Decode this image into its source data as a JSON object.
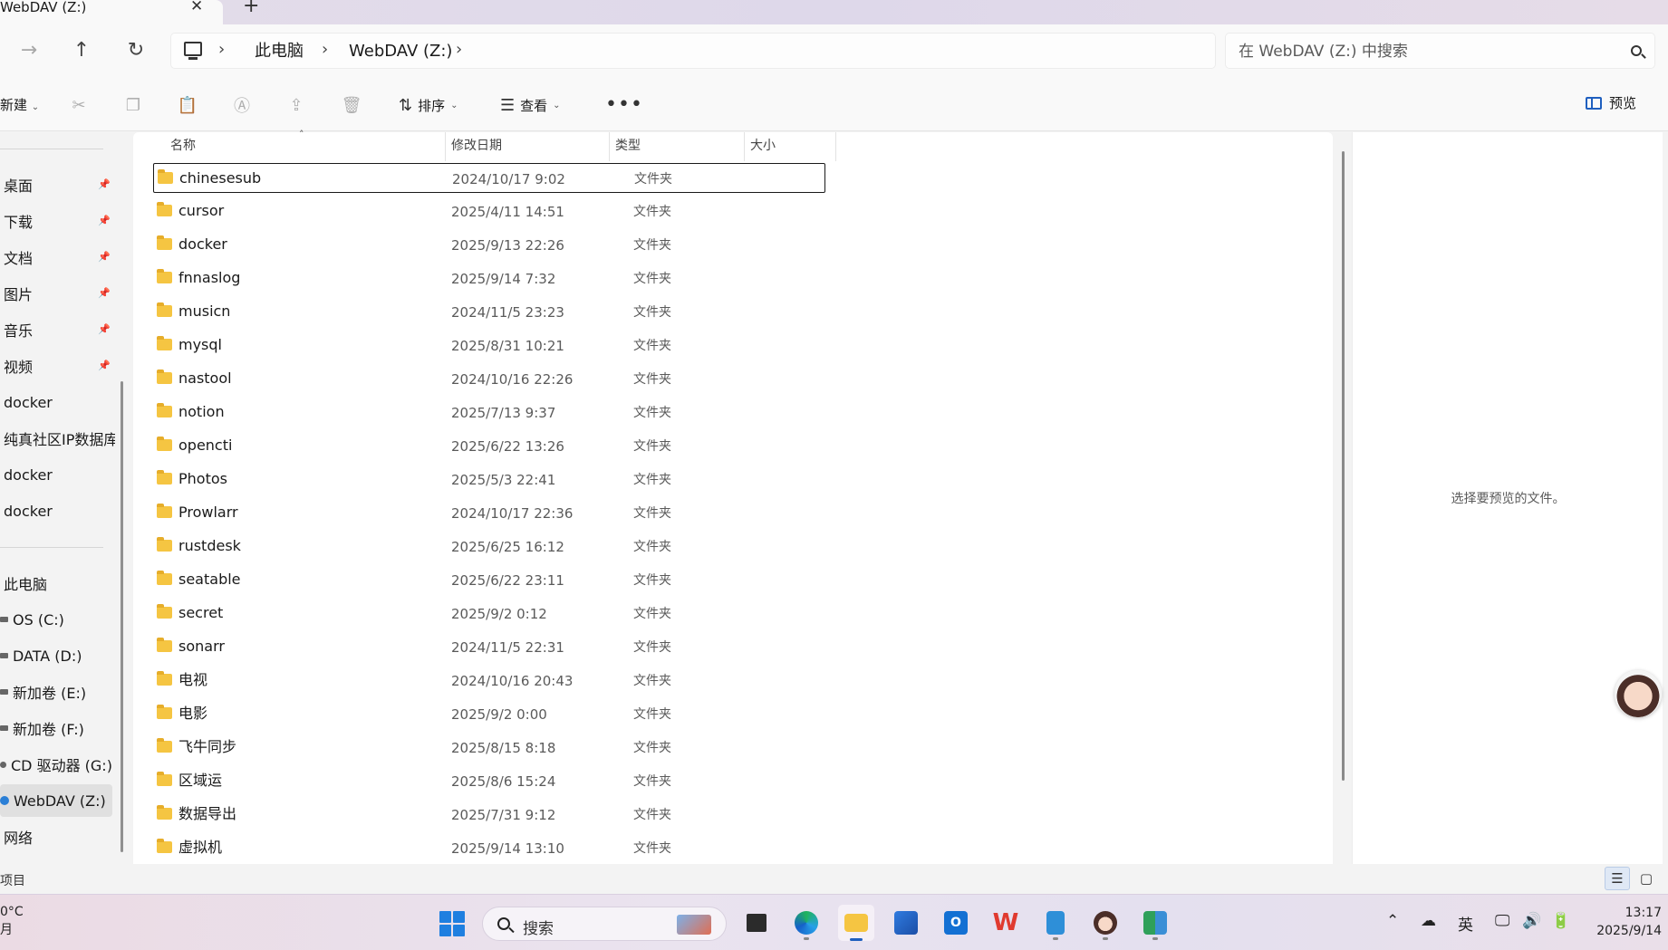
{
  "window": {
    "tab_title": "WebDAV (Z:)",
    "tab_close": "✕",
    "tab_new": "+"
  },
  "address": {
    "breadcrumbs": [
      "此电脑",
      "WebDAV (Z:)"
    ],
    "search_placeholder": "在 WebDAV (Z:) 中搜索"
  },
  "toolbar": {
    "new_label": "新建",
    "sort_label": "排序",
    "view_label": "查看",
    "more": "•••",
    "preview_label": "预览",
    "icons": [
      "cut-icon",
      "copy-icon",
      "paste-icon",
      "rename-icon",
      "share-icon",
      "delete-icon"
    ]
  },
  "sidebar": {
    "quick_access": [
      {
        "label": "桌面",
        "pinned": true
      },
      {
        "label": "下载",
        "pinned": true
      },
      {
        "label": "文档",
        "pinned": true
      },
      {
        "label": "图片",
        "pinned": true
      },
      {
        "label": "音乐",
        "pinned": true
      },
      {
        "label": "视频",
        "pinned": true
      },
      {
        "label": "docker",
        "pinned": false
      },
      {
        "label": "纯真社区IP数据库",
        "pinned": false
      },
      {
        "label": "docker",
        "pinned": false
      },
      {
        "label": "docker",
        "pinned": false
      }
    ],
    "this_pc": "此电脑",
    "drives": [
      "OS (C:)",
      "DATA (D:)",
      "新加卷 (E:)",
      "新加卷 (F:)",
      "CD 驱动器 (G:)",
      "WebDAV (Z:)"
    ],
    "network": "网络",
    "selected_drive": "WebDAV (Z:)"
  },
  "columns": {
    "name": "名称",
    "modified": "修改日期",
    "type": "类型",
    "size": "大小"
  },
  "files": [
    {
      "name": "chinesesub",
      "modified": "2024/10/17 9:02",
      "type": "文件夹",
      "selected": true
    },
    {
      "name": "cursor",
      "modified": "2025/4/11 14:51",
      "type": "文件夹"
    },
    {
      "name": "docker",
      "modified": "2025/9/13 22:26",
      "type": "文件夹"
    },
    {
      "name": "fnnaslog",
      "modified": "2025/9/14 7:32",
      "type": "文件夹"
    },
    {
      "name": "musicn",
      "modified": "2024/11/5 23:23",
      "type": "文件夹"
    },
    {
      "name": "mysql",
      "modified": "2025/8/31 10:21",
      "type": "文件夹"
    },
    {
      "name": "nastool",
      "modified": "2024/10/16 22:26",
      "type": "文件夹"
    },
    {
      "name": "notion",
      "modified": "2025/7/13 9:37",
      "type": "文件夹"
    },
    {
      "name": "opencti",
      "modified": "2025/6/22 13:26",
      "type": "文件夹"
    },
    {
      "name": "Photos",
      "modified": "2025/5/3 22:41",
      "type": "文件夹"
    },
    {
      "name": "Prowlarr",
      "modified": "2024/10/17 22:36",
      "type": "文件夹"
    },
    {
      "name": "rustdesk",
      "modified": "2025/6/25 16:12",
      "type": "文件夹"
    },
    {
      "name": "seatable",
      "modified": "2025/6/22 23:11",
      "type": "文件夹"
    },
    {
      "name": "secret",
      "modified": "2025/9/2 0:12",
      "type": "文件夹"
    },
    {
      "name": "sonarr",
      "modified": "2024/11/5 22:31",
      "type": "文件夹"
    },
    {
      "name": "电视",
      "modified": "2024/10/16 20:43",
      "type": "文件夹"
    },
    {
      "name": "电影",
      "modified": "2025/9/2 0:00",
      "type": "文件夹"
    },
    {
      "name": "飞牛同步",
      "modified": "2025/8/15 8:18",
      "type": "文件夹"
    },
    {
      "name": "区域运",
      "modified": "2025/8/6 15:24",
      "type": "文件夹"
    },
    {
      "name": "数据导出",
      "modified": "2025/7/31 9:12",
      "type": "文件夹"
    },
    {
      "name": "虚拟机",
      "modified": "2025/9/14 13:10",
      "type": "文件夹"
    }
  ],
  "preview_pane": {
    "message": "选择要预览的文件。"
  },
  "status_bar": {
    "text": "项目"
  },
  "taskbar": {
    "weather_temp": "0°C",
    "weather_sub": "月",
    "search_label": "搜索",
    "ime": "英",
    "time": "13:17",
    "date": "2025/9/14"
  },
  "colors": {
    "accent": "#1f5fbf",
    "folder": "#f5c542"
  }
}
